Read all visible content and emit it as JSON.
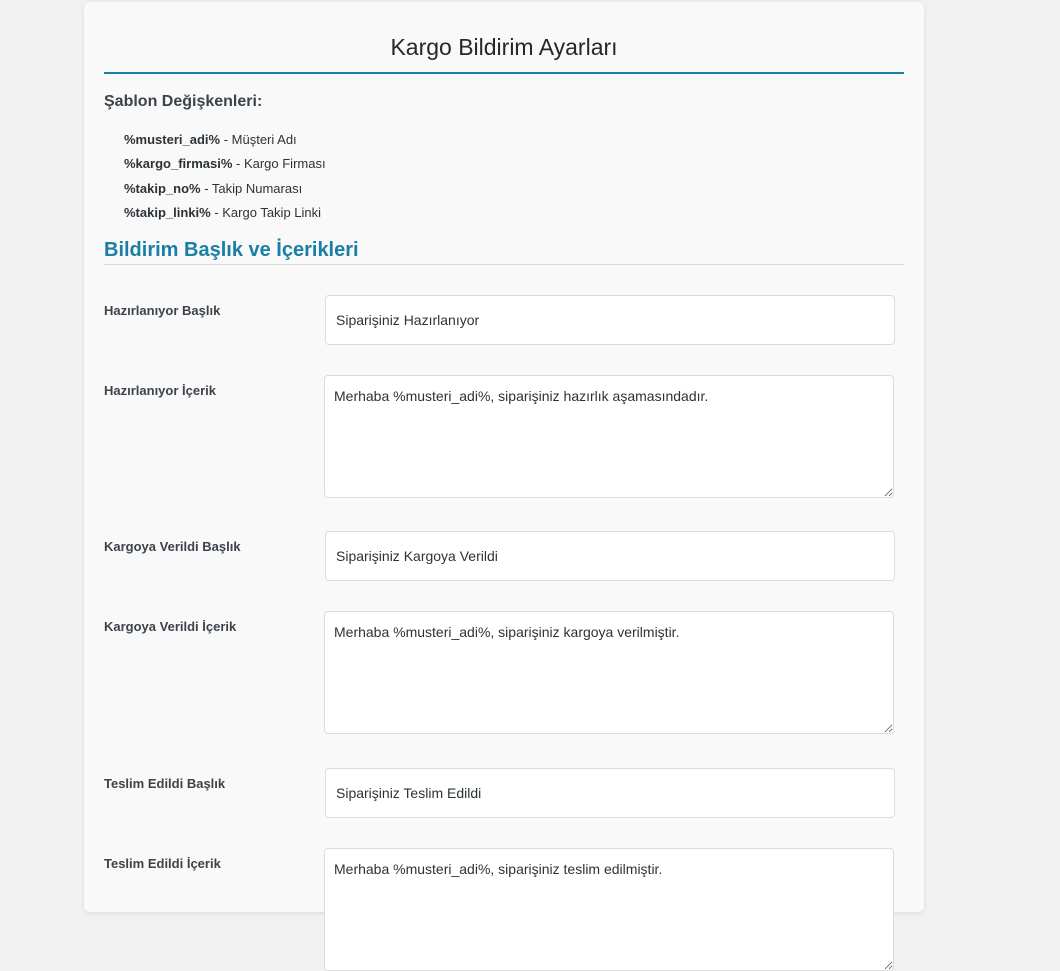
{
  "page": {
    "title": "Kargo Bildirim Ayarları"
  },
  "variables": {
    "heading": "Şablon Değişkenleri:",
    "items": [
      {
        "code": "%musteri_adi%",
        "desc": " - Müşteri Adı"
      },
      {
        "code": "%kargo_firmasi%",
        "desc": " - Kargo Firması"
      },
      {
        "code": "%takip_no%",
        "desc": " - Takip Numarası"
      },
      {
        "code": "%takip_linki%",
        "desc": " - Kargo Takip Linki"
      }
    ]
  },
  "section": {
    "heading": "Bildirim Başlık ve İçerikleri"
  },
  "fields": {
    "preparing_title": {
      "label": "Hazırlanıyor Başlık",
      "value": "Siparişiniz Hazırlanıyor"
    },
    "preparing_content": {
      "label": "Hazırlanıyor İçerik",
      "value": "Merhaba %musteri_adi%, siparişiniz hazırlık aşamasındadır."
    },
    "shipped_title": {
      "label": "Kargoya Verildi Başlık",
      "value": "Siparişiniz Kargoya Verildi"
    },
    "shipped_content": {
      "label": "Kargoya Verildi İçerik",
      "value": "Merhaba %musteri_adi%, siparişiniz kargoya verilmiştir."
    },
    "delivered_title": {
      "label": "Teslim Edildi Başlık",
      "value": "Siparişiniz Teslim Edildi"
    },
    "delivered_content": {
      "label": "Teslim Edildi İçerik",
      "value": "Merhaba %musteri_adi%, siparişiniz teslim edilmiştir."
    }
  },
  "colors": {
    "accent": "#1a7ea6",
    "page_background": "#f1f1f1",
    "card_background": "#f9f9f9"
  }
}
